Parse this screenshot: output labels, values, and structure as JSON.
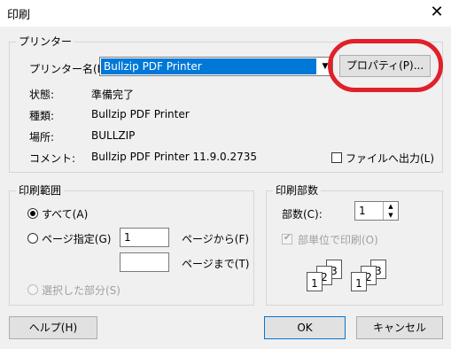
{
  "window": {
    "title": "印刷",
    "close_glyph": "✕"
  },
  "printer": {
    "group_label": "プリンター",
    "name_label": "プリンター名(N):",
    "name_value": "Bullzip PDF Printer",
    "properties_button": "プロパティ(P)...",
    "status_label": "状態:",
    "status_value": "準備完了",
    "type_label": "種類:",
    "type_value": "Bullzip PDF Printer",
    "where_label": "場所:",
    "where_value": "BULLZIP",
    "comment_label": "コメント:",
    "comment_value": "Bullzip PDF Printer 11.9.0.2735",
    "print_to_file_label": "ファイルへ出力(L)",
    "print_to_file_checked": false
  },
  "range": {
    "group_label": "印刷範囲",
    "all_label": "すべて(A)",
    "all_selected": true,
    "pages_label": "ページ指定(G)",
    "from_value": "1",
    "from_suffix": "ページから(F)",
    "to_value": "",
    "to_suffix": "ページまで(T)",
    "selection_label": "選択した部分(S)"
  },
  "copies": {
    "group_label": "印刷部数",
    "count_label": "部数(C):",
    "count_value": "1",
    "collate_label": "部単位で印刷(O)",
    "collate_checked": true,
    "collate_pages": [
      "1",
      "2",
      "3"
    ]
  },
  "buttons": {
    "help": "ヘルプ(H)",
    "ok": "OK",
    "cancel": "キャンセル"
  },
  "colors": {
    "highlight": "#0078d7",
    "annotation_circle": "#e0202a"
  }
}
